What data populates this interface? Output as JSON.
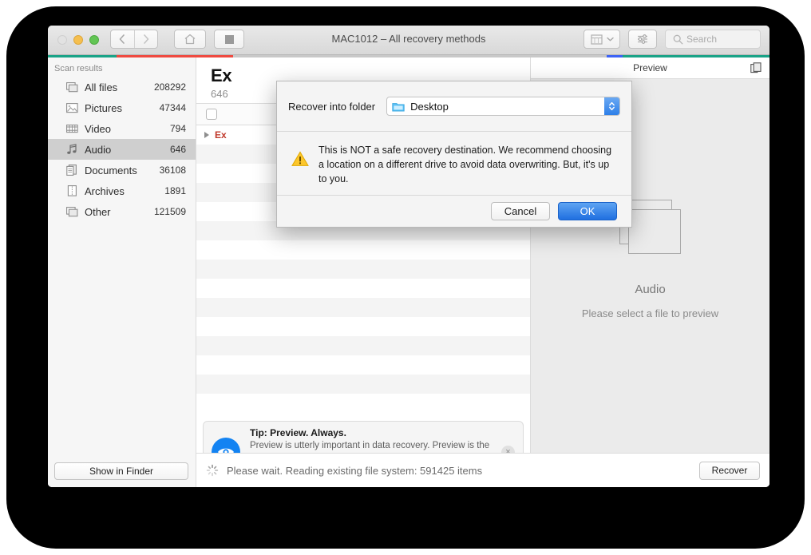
{
  "window": {
    "title": "MAC1012 – All recovery methods",
    "traffic_lights": [
      "close-button",
      "minimize-button",
      "maximize-button"
    ],
    "toolbar": {
      "back_icon": "chevron-left-icon",
      "forward_icon": "chevron-right-icon",
      "home_icon": "home-icon",
      "stop_icon": "stop-icon",
      "view_icon": "view-mode-icon",
      "view_chevron": "chevron-down-icon",
      "filter_icon": "filter-sliders-icon",
      "search_placeholder": "Search",
      "search_icon": "search-icon"
    },
    "accent_colors": {
      "teal": "#19a387",
      "red": "#ef4a40",
      "blue": "#3d63f5",
      "grey": "#c8c8c8"
    }
  },
  "sidebar": {
    "header": "Scan results",
    "items": [
      {
        "icon": "all-files-icon",
        "label": "All files",
        "count": "208292",
        "selected": false
      },
      {
        "icon": "pictures-icon",
        "label": "Pictures",
        "count": "47344",
        "selected": false
      },
      {
        "icon": "video-icon",
        "label": "Video",
        "count": "794",
        "selected": false
      },
      {
        "icon": "audio-icon",
        "label": "Audio",
        "count": "646",
        "selected": true
      },
      {
        "icon": "documents-icon",
        "label": "Documents",
        "count": "36108",
        "selected": false
      },
      {
        "icon": "archives-icon",
        "label": "Archives",
        "count": "1891",
        "selected": false
      },
      {
        "icon": "other-icon",
        "label": "Other",
        "count": "121509",
        "selected": false
      }
    ],
    "show_in_finder": "Show in Finder"
  },
  "center": {
    "title": "Ex",
    "subtitle": "646",
    "row_label": "Ex",
    "tip": {
      "icon": "eye-icon",
      "title": "Tip: Preview. Always.",
      "text": "Preview is utterly important in data recovery. Preview is the only way to verify that your files are recoverable and not corrupted.",
      "close_icon": "close-icon",
      "close_label": "×"
    }
  },
  "preview": {
    "header": "Preview",
    "copy_icon": "copy-icon",
    "placeholder_icon": "stacked-files-icon",
    "kind": "Audio",
    "hint": "Please select a file to preview"
  },
  "status": {
    "spinner_icon": "loading-spinner-icon",
    "text": "Please wait. Reading existing file system: 591425 items",
    "recover_label": "Recover"
  },
  "dialog": {
    "folder_label": "Recover into folder",
    "folder_icon": "folder-icon",
    "folder_value": "Desktop",
    "stepper_icon": "stepper-updown-icon",
    "warning_icon": "warning-triangle-icon",
    "message": "This is NOT a safe recovery destination. We recommend choosing a location on a different drive to avoid data overwriting. But, it's up to you.",
    "cancel_label": "Cancel",
    "ok_label": "OK"
  }
}
